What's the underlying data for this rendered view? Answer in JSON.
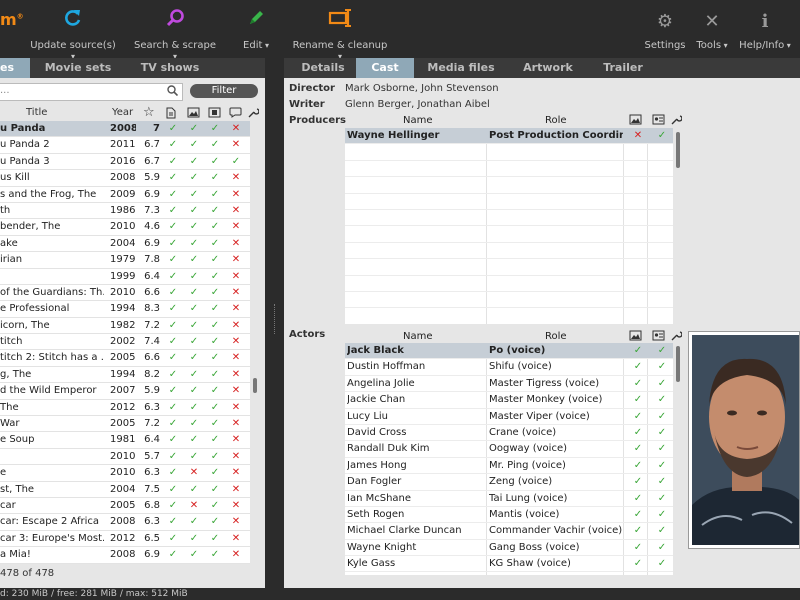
{
  "toolbar": {
    "logo": "m",
    "logo_mark": "®",
    "update_sources": "Update source(s)",
    "search_scrape": "Search & scrape",
    "edit": "Edit",
    "rename_cleanup": "Rename & cleanup",
    "settings": "Settings",
    "tools": "Tools",
    "help": "Help/Info",
    "colors": {
      "update": "#1ea7e0",
      "search": "#c04adf",
      "edit": "#39b54a",
      "rename": "#f28a16"
    }
  },
  "main_tabs": {
    "movies": "es",
    "movie_sets": "Movie sets",
    "tv_shows": "TV shows"
  },
  "detail_tabs": {
    "details": "Details",
    "cast": "Cast",
    "media_files": "Media files",
    "artwork": "Artwork",
    "trailer": "Trailer"
  },
  "search": {
    "placeholder": "...",
    "filter": "Filter"
  },
  "movie_table": {
    "title_header": "Title",
    "year_header": "Year",
    "rows": [
      {
        "title": "u Panda",
        "year": "2008",
        "rating": "7",
        "flags": [
          "ok",
          "ok",
          "ok",
          "no"
        ]
      },
      {
        "title": "u Panda 2",
        "year": "2011",
        "rating": "6.7",
        "flags": [
          "ok",
          "ok",
          "ok",
          "no"
        ]
      },
      {
        "title": "u Panda 3",
        "year": "2016",
        "rating": "6.7",
        "flags": [
          "ok",
          "ok",
          "ok",
          "ok"
        ]
      },
      {
        "title": "us Kill",
        "year": "2008",
        "rating": "5.9",
        "flags": [
          "ok",
          "ok",
          "ok",
          "no"
        ]
      },
      {
        "title": "s and the Frog, The",
        "year": "2009",
        "rating": "6.9",
        "flags": [
          "ok",
          "ok",
          "ok",
          "no"
        ]
      },
      {
        "title": "th",
        "year": "1986",
        "rating": "7.3",
        "flags": [
          "ok",
          "ok",
          "ok",
          "no"
        ]
      },
      {
        "title": "bender, The",
        "year": "2010",
        "rating": "4.6",
        "flags": [
          "ok",
          "ok",
          "ok",
          "no"
        ]
      },
      {
        "title": "ake",
        "year": "2004",
        "rating": "6.9",
        "flags": [
          "ok",
          "ok",
          "ok",
          "no"
        ]
      },
      {
        "title": "irian",
        "year": "1979",
        "rating": "7.8",
        "flags": [
          "ok",
          "ok",
          "ok",
          "no"
        ]
      },
      {
        "title": "",
        "year": "1999",
        "rating": "6.4",
        "flags": [
          "ok",
          "ok",
          "ok",
          "no"
        ]
      },
      {
        "title": "of the Guardians: Th...",
        "year": "2010",
        "rating": "6.6",
        "flags": [
          "ok",
          "ok",
          "ok",
          "no"
        ]
      },
      {
        "title": "e Professional",
        "year": "1994",
        "rating": "8.3",
        "flags": [
          "ok",
          "ok",
          "ok",
          "no"
        ]
      },
      {
        "title": "icorn, The",
        "year": "1982",
        "rating": "7.2",
        "flags": [
          "ok",
          "ok",
          "ok",
          "no"
        ]
      },
      {
        "title": "titch",
        "year": "2002",
        "rating": "7.4",
        "flags": [
          "ok",
          "ok",
          "ok",
          "no"
        ]
      },
      {
        "title": "titch 2: Stitch has a ...",
        "year": "2005",
        "rating": "6.6",
        "flags": [
          "ok",
          "ok",
          "ok",
          "no"
        ]
      },
      {
        "title": "g, The",
        "year": "1994",
        "rating": "8.2",
        "flags": [
          "ok",
          "ok",
          "ok",
          "no"
        ]
      },
      {
        "title": "d the Wild Emperor",
        "year": "2007",
        "rating": "5.9",
        "flags": [
          "ok",
          "ok",
          "ok",
          "no"
        ]
      },
      {
        "title": "The",
        "year": "2012",
        "rating": "6.3",
        "flags": [
          "ok",
          "ok",
          "ok",
          "no"
        ]
      },
      {
        "title": "War",
        "year": "2005",
        "rating": "7.2",
        "flags": [
          "ok",
          "ok",
          "ok",
          "no"
        ]
      },
      {
        "title": "e Soup",
        "year": "1981",
        "rating": "6.4",
        "flags": [
          "ok",
          "ok",
          "ok",
          "no"
        ]
      },
      {
        "title": "",
        "year": "2010",
        "rating": "5.7",
        "flags": [
          "ok",
          "ok",
          "ok",
          "no"
        ]
      },
      {
        "title": "e",
        "year": "2010",
        "rating": "6.3",
        "flags": [
          "ok",
          "no",
          "ok",
          "no"
        ]
      },
      {
        "title": "st, The",
        "year": "2004",
        "rating": "7.5",
        "flags": [
          "ok",
          "ok",
          "ok",
          "no"
        ]
      },
      {
        "title": "car",
        "year": "2005",
        "rating": "6.8",
        "flags": [
          "ok",
          "no",
          "ok",
          "no"
        ]
      },
      {
        "title": "car: Escape 2 Africa",
        "year": "2008",
        "rating": "6.3",
        "flags": [
          "ok",
          "ok",
          "ok",
          "no"
        ]
      },
      {
        "title": "car 3: Europe's Most...",
        "year": "2012",
        "rating": "6.5",
        "flags": [
          "ok",
          "ok",
          "ok",
          "no"
        ]
      },
      {
        "title": "a Mia!",
        "year": "2008",
        "rating": "6.9",
        "flags": [
          "ok",
          "ok",
          "ok",
          "no"
        ]
      }
    ],
    "count": "478 of 478"
  },
  "details": {
    "director_label": "Director",
    "director": "Mark Osborne, John Stevenson",
    "writer_label": "Writer",
    "writer": "Glenn Berger, Jonathan Aibel",
    "producers_label": "Producers",
    "actors_label": "Actors",
    "name_header": "Name",
    "role_header": "Role",
    "producers": [
      {
        "name": "Wayne Hellinger",
        "role": "Post Production Coordinator",
        "img": "no",
        "thumb": "ok"
      }
    ],
    "actors": [
      {
        "name": "Jack Black",
        "role": "Po (voice)"
      },
      {
        "name": "Dustin Hoffman",
        "role": "Shifu (voice)"
      },
      {
        "name": "Angelina Jolie",
        "role": "Master Tigress (voice)"
      },
      {
        "name": "Jackie Chan",
        "role": "Master Monkey (voice)"
      },
      {
        "name": "Lucy Liu",
        "role": "Master Viper (voice)"
      },
      {
        "name": "David Cross",
        "role": "Crane (voice)"
      },
      {
        "name": "Randall Duk Kim",
        "role": "Oogway (voice)"
      },
      {
        "name": "James Hong",
        "role": "Mr. Ping (voice)"
      },
      {
        "name": "Dan Fogler",
        "role": "Zeng (voice)"
      },
      {
        "name": "Ian McShane",
        "role": "Tai Lung (voice)"
      },
      {
        "name": "Seth Rogen",
        "role": "Mantis (voice)"
      },
      {
        "name": "Michael Clarke Duncan",
        "role": "Commander Vachir (voice)"
      },
      {
        "name": "Wayne Knight",
        "role": "Gang Boss (voice)"
      },
      {
        "name": "Kyle Gass",
        "role": "KG Shaw (voice)"
      }
    ]
  },
  "status": "d: 230 MiB  /  free: 281 MiB  /  max: 512 MiB"
}
